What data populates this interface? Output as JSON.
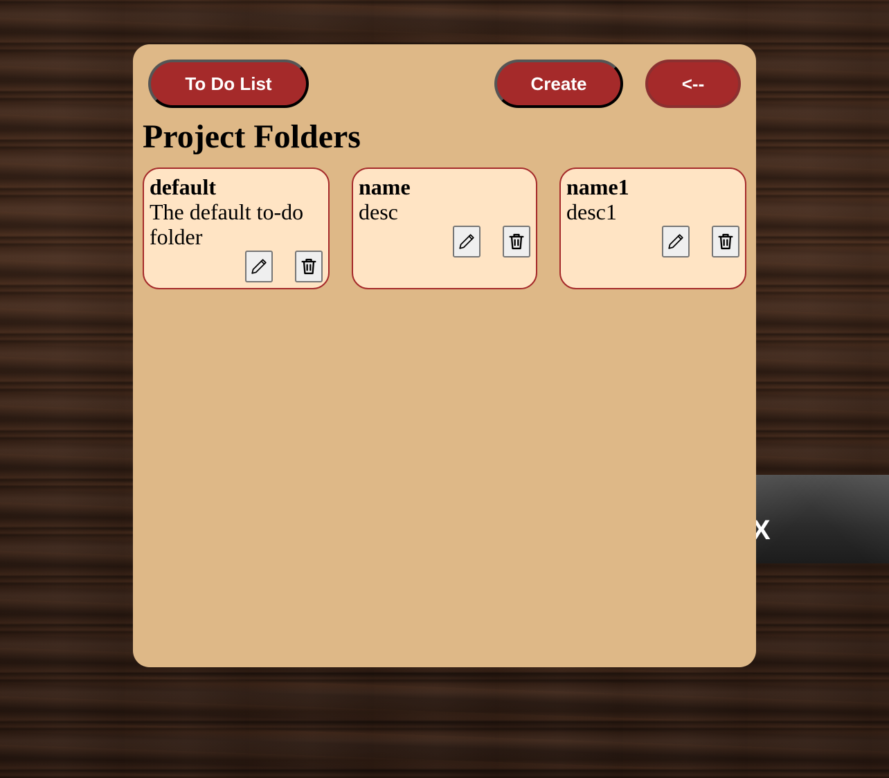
{
  "nav": {
    "todo_label": "To Do List",
    "create_label": "Create",
    "back_label": "<--"
  },
  "page": {
    "title": "Project Folders"
  },
  "folders": [
    {
      "name": "default",
      "description": "The default to-do folder",
      "edit_icon": "pencil-icon",
      "delete_icon": "trash-icon"
    },
    {
      "name": "name",
      "description": "desc",
      "edit_icon": "pencil-icon",
      "delete_icon": "trash-icon"
    },
    {
      "name": "name1",
      "description": "desc1",
      "edit_icon": "pencil-icon",
      "delete_icon": "trash-icon"
    }
  ],
  "background_overlay": {
    "glyph": "X"
  },
  "colors": {
    "card_background": "#deb887",
    "folder_background": "#ffe4c4",
    "accent": "#a52a2a",
    "button_text": "#ffffff"
  }
}
